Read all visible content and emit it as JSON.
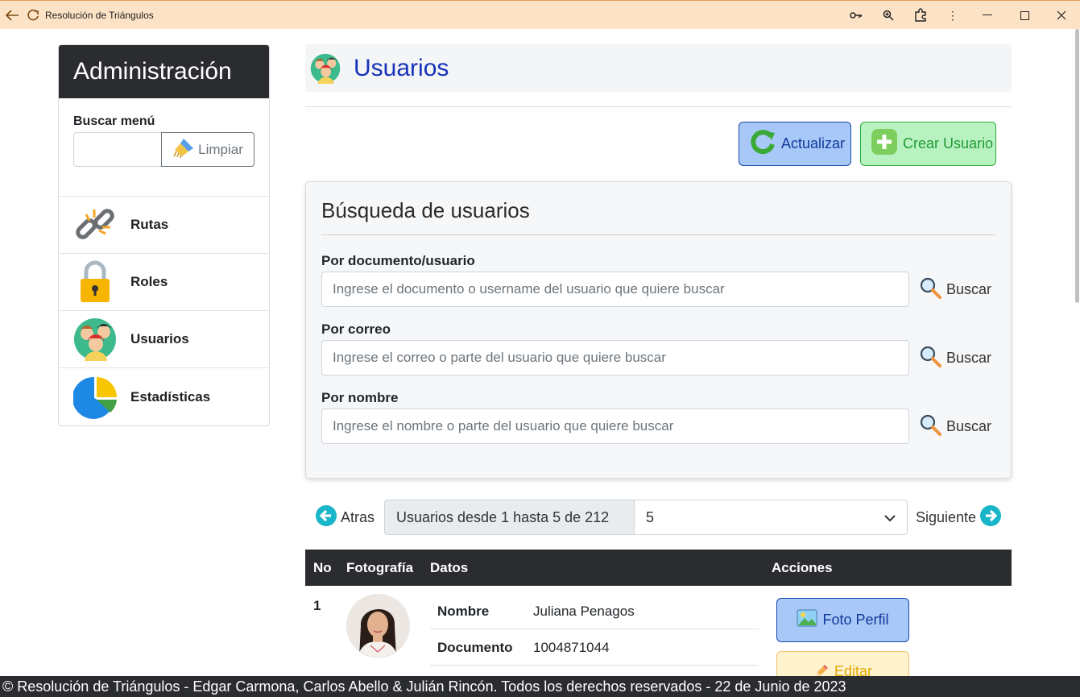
{
  "window": {
    "title": "Resolución de Triángulos",
    "back_icon": "arrow-left-icon",
    "reload_icon": "reload-icon",
    "tools": [
      "key-icon",
      "zoom-icon",
      "extensions-icon",
      "more-icon"
    ],
    "controls": [
      "minimize-icon",
      "maximize-icon",
      "close-icon"
    ]
  },
  "sidebar": {
    "title": "Administración",
    "search_label": "Buscar menú",
    "clear_label": "Limpiar",
    "items": [
      {
        "label": "Rutas",
        "icon": "link-icon"
      },
      {
        "label": "Roles",
        "icon": "lock-icon"
      },
      {
        "label": "Usuarios",
        "icon": "users-icon"
      },
      {
        "label": "Estadísticas",
        "icon": "pie-chart-icon"
      }
    ]
  },
  "main": {
    "title": "Usuarios",
    "refresh_label": "Actualizar",
    "create_label": "Crear Usuario",
    "search": {
      "title": "Búsqueda de usuarios",
      "fields": [
        {
          "label": "Por documento/usuario",
          "placeholder": "Ingrese el documento o username del usuario que quiere buscar",
          "button": "Buscar"
        },
        {
          "label": "Por correo",
          "placeholder": "Ingrese el correo o parte del usuario que quiere buscar",
          "button": "Buscar"
        },
        {
          "label": "Por nombre",
          "placeholder": "Ingrese el nombre o parte del usuario que quiere buscar",
          "button": "Buscar"
        }
      ]
    },
    "pager": {
      "prev": "Atras",
      "info": "Usuarios desde 1 hasta 5 de 212",
      "page_size": "5",
      "next": "Siguiente"
    },
    "table": {
      "headers": [
        "No",
        "Fotografía",
        "Datos",
        "Acciones"
      ],
      "rows": [
        {
          "no": "1",
          "data": [
            {
              "key": "Nombre",
              "value": "Juliana Penagos"
            },
            {
              "key": "Documento",
              "value": "1004871044"
            }
          ],
          "actions": [
            "Foto Perfil",
            "Editar"
          ]
        }
      ]
    }
  },
  "footer": "© Resolución de Triángulos - Edgar Carmona, Carlos Abello & Julián Rincón. Todos los derechos reservados - 22 de Junio de 2023"
}
